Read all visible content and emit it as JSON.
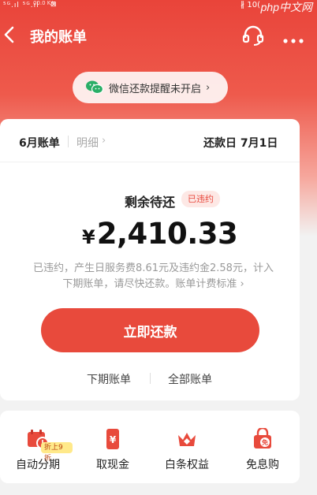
{
  "status_bar": {
    "signal": "⁵ᴳ.ıl ⁵ᴳ.ıl",
    "speed": "00.0 K/s",
    "bluetooth": "∦",
    "battery": "10(",
    "watermark": "php中文网"
  },
  "header": {
    "title": "我的账单"
  },
  "wechat_reminder": {
    "label": "微信还款提醒未开启",
    "chevron": "›"
  },
  "bill_card": {
    "month_tab": "6月账单",
    "detail_tab": "明细",
    "detail_chevron": "›",
    "due_date": "还款日 7月1日",
    "remaining_label": "剩余待还",
    "status_badge": "已违约",
    "currency": "¥",
    "amount": "2,410.33",
    "notice_line1": "已违约，产生日服务费8.61元及违约金2.58元，计入",
    "notice_line2": "下期账单，请尽快还款。账单计费标准 ›",
    "pay_button": "立即还款",
    "next_bill_link": "下期账单",
    "all_bills_link": "全部账单"
  },
  "services": {
    "items": [
      {
        "label": "自动分期",
        "icon": "calendar-clock-icon",
        "badge": "折上9折"
      },
      {
        "label": "取现金",
        "icon": "cash-phone-icon"
      },
      {
        "label": "白条权益",
        "icon": "crown-icon"
      },
      {
        "label": "免息购",
        "icon": "shopping-bag-icon"
      }
    ]
  },
  "colors": {
    "brand_red": "#e84a3c",
    "badge_bg": "#fde8e5",
    "wechat_green": "#2aae67"
  }
}
